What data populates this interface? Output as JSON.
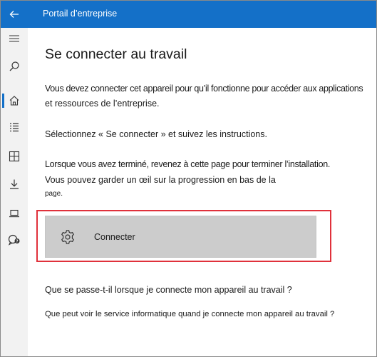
{
  "app": {
    "title": "Portail d’entreprise"
  },
  "sidebar": {
    "items": [
      {
        "icon": "hamburger-menu-icon"
      },
      {
        "icon": "search-icon"
      },
      {
        "icon": "home-icon",
        "active": true
      },
      {
        "icon": "list-icon"
      },
      {
        "icon": "apps-grid-icon"
      },
      {
        "icon": "download-icon"
      },
      {
        "icon": "laptop-icon"
      },
      {
        "icon": "help-chat-icon"
      }
    ]
  },
  "main": {
    "title": "Se connecter au travail",
    "intro_line1": "Vous devez connecter cet appareil pour qu’il fonctionne pour accéder aux applications",
    "intro_line2": "et ressources de l’entreprise.",
    "select_text": "Sélectionnez « Se connecter » et suivez les instructions.",
    "finish_line1": "Lorsque vous avez terminé, revenez à cette page pour terminer l’installation.",
    "finish_line2": "Vous pouvez garder un œil sur la progression en bas de la",
    "finish_line3": "page.",
    "connect_button": {
      "label": "Connecter",
      "icon": "gear-icon"
    },
    "link1": "Que se passe-t-il lorsque je connecte mon appareil au travail ?",
    "link2": "Que peut voir le service informatique quand je connecte mon appareil au travail ?"
  },
  "colors": {
    "accent": "#1470c8",
    "highlight": "#e0313b",
    "button_bg": "#cccccc",
    "sidebar_bg": "#f2f2f2"
  }
}
